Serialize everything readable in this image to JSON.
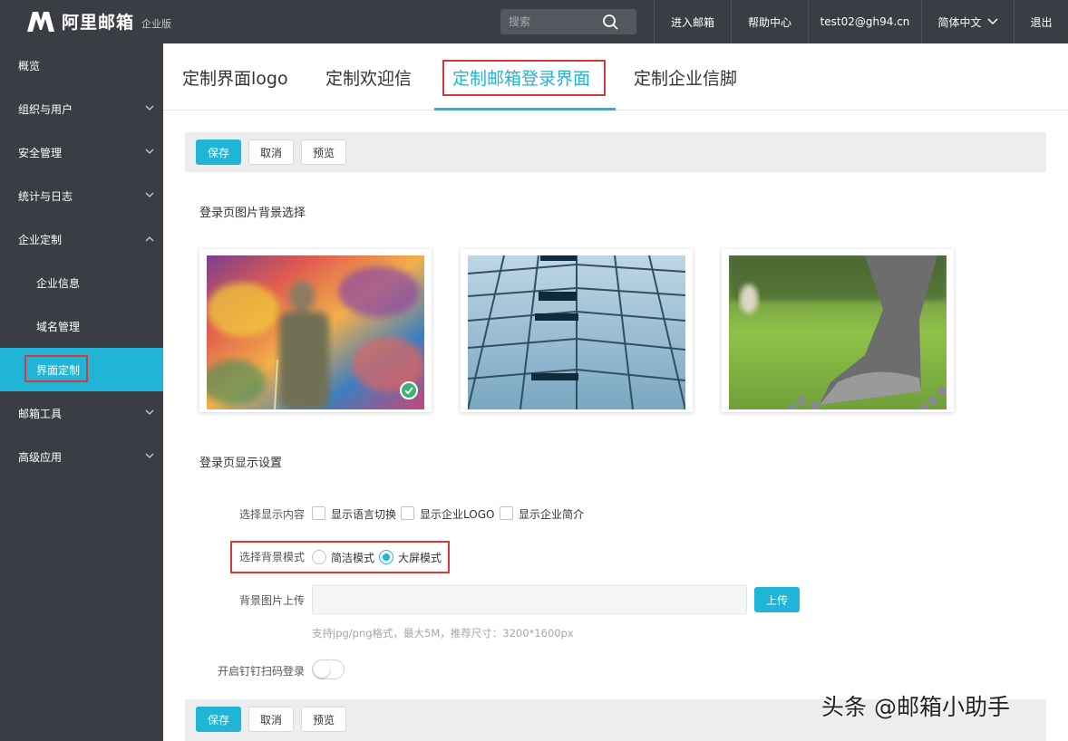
{
  "brand": {
    "name": "阿里邮箱",
    "edition": "企业版"
  },
  "header": {
    "search_placeholder": "搜索",
    "nav": [
      {
        "label": "进入邮箱"
      },
      {
        "label": "帮助中心"
      },
      {
        "label": "test02@gh94.cn"
      },
      {
        "label": "简体中文"
      },
      {
        "label": "退出"
      }
    ]
  },
  "sidebar": {
    "items": [
      {
        "label": "概览"
      },
      {
        "label": "组织与用户"
      },
      {
        "label": "安全管理"
      },
      {
        "label": "统计与日志"
      },
      {
        "label": "企业定制"
      },
      {
        "label": "企业信息"
      },
      {
        "label": "域名管理"
      },
      {
        "label": "界面定制"
      },
      {
        "label": "邮箱工具"
      },
      {
        "label": "高级应用"
      }
    ]
  },
  "tabs": [
    {
      "label": "定制界面logo"
    },
    {
      "label": "定制欢迎信"
    },
    {
      "label": "定制邮箱登录界面"
    },
    {
      "label": "定制企业信脚"
    }
  ],
  "toolbar": {
    "save": "保存",
    "cancel": "取消",
    "preview": "预览"
  },
  "bg_section": {
    "title": "登录页图片背景选择"
  },
  "display_section": {
    "title": "登录页显示设置",
    "content_label": "选择显示内容",
    "content_options": [
      "显示语言切换",
      "显示企业LOGO",
      "显示企业简介"
    ],
    "mode_label": "选择背景模式",
    "mode_options": [
      "简洁模式",
      "大屏模式"
    ],
    "selected_mode": "大屏模式",
    "upload_label": "背景图片上传",
    "upload_button": "上传",
    "upload_hint": "支持jpg/png格式，最大5M，推荐尺寸：3200*1600px",
    "dingtalk_label": "开启钉钉扫码登录"
  },
  "watermark": "头条 @邮箱小助手",
  "colors": {
    "accent": "#20b5d6",
    "sidebar": "#3a3d43",
    "highlight": "#d83a3a"
  }
}
